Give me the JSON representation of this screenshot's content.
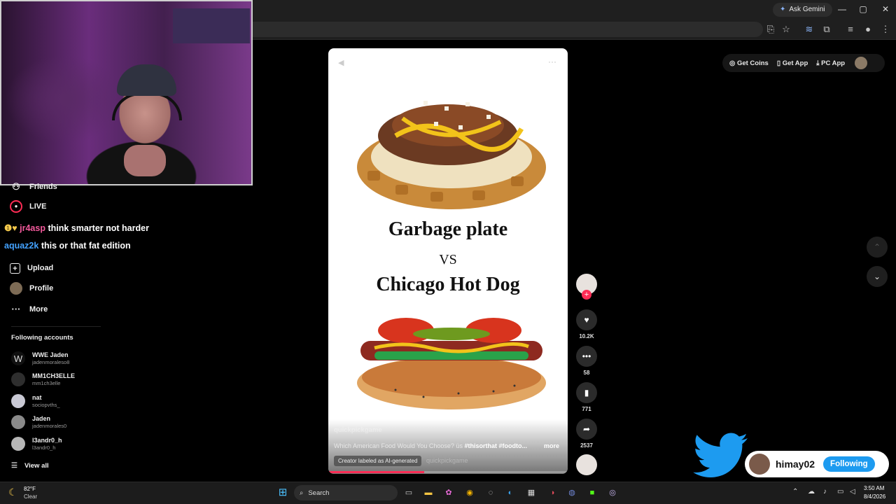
{
  "browser": {
    "ask_gemini": "Ask Gemini"
  },
  "tiktok_topbar": {
    "get_coins": "Get Coins",
    "get_app": "Get App",
    "pc_app": "PC App"
  },
  "sidebar": {
    "friends": "Friends",
    "live": "LIVE",
    "upload": "Upload",
    "profile": "Profile",
    "more": "More",
    "following_header": "Following accounts",
    "accounts": [
      {
        "name": "WWE Jaden",
        "handle": "jadenmoraleso8"
      },
      {
        "name": "MM1CH3ELLE",
        "handle": "mm1ch3elle"
      },
      {
        "name": "nat",
        "handle": "sociopvths_"
      },
      {
        "name": "Jaden",
        "handle": "jadenmorales0"
      },
      {
        "name": "l3andr0_h",
        "handle": "l3andr0_h"
      }
    ],
    "view_all": "View all"
  },
  "chat": [
    {
      "user": "jr4asp",
      "message": "think smarter not harder"
    },
    {
      "user": "aquaz2k",
      "message": "this or that fat edition"
    }
  ],
  "video": {
    "title_top": "Garbage plate",
    "vs": "VS",
    "title_bottom": "Chicago Hot Dog",
    "username": "quickpickgame",
    "caption": "Which American Food Would You Choose? üs ",
    "hashtags": "#thisorthat #foodto...",
    "more": "more",
    "ai_label": "Creator labeled as AI-generated",
    "sound_user": "quickpickgame",
    "progress": 0.4
  },
  "actions": {
    "likes": "10.2K",
    "comments": "58",
    "saves": "771",
    "shares": "2537"
  },
  "overlay": {
    "twitter_name": "himay02",
    "twitter_status": "Following"
  },
  "taskbar": {
    "temp": "82°F",
    "weather": "Clear",
    "search": "Search",
    "time": "3:50 AM",
    "date": "8/4/2026"
  },
  "colors": {
    "tiktok_red": "#fe2c55",
    "twitter_blue": "#1d9bf0"
  }
}
